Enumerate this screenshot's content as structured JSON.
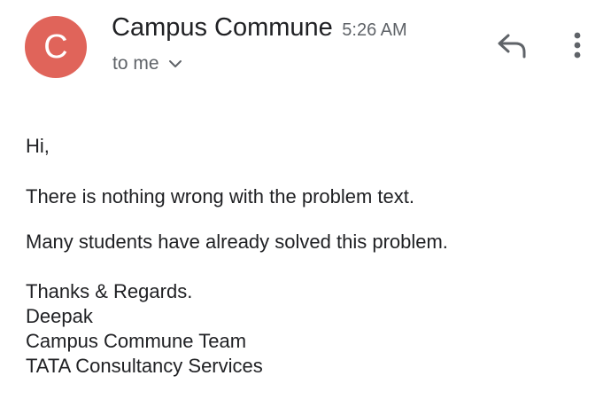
{
  "header": {
    "avatar_letter": "C",
    "sender_name": "Campus Commune",
    "time": "5:26 AM",
    "recipient": "to me"
  },
  "icons": {
    "avatar": "avatar",
    "expand": "chevron-down-icon",
    "reply": "reply-icon",
    "more": "more-vert-icon"
  },
  "colors": {
    "avatar_bg": "#e0645a",
    "text_primary": "#202124",
    "text_secondary": "#5f6368"
  },
  "body": {
    "greeting": "Hi,",
    "paragraphs": [
      "There is nothing wrong with the problem text.",
      "Many students have already solved this problem."
    ],
    "signature": [
      "Thanks & Regards.",
      "Deepak",
      "Campus Commune Team",
      "TATA Consultancy Services"
    ]
  }
}
